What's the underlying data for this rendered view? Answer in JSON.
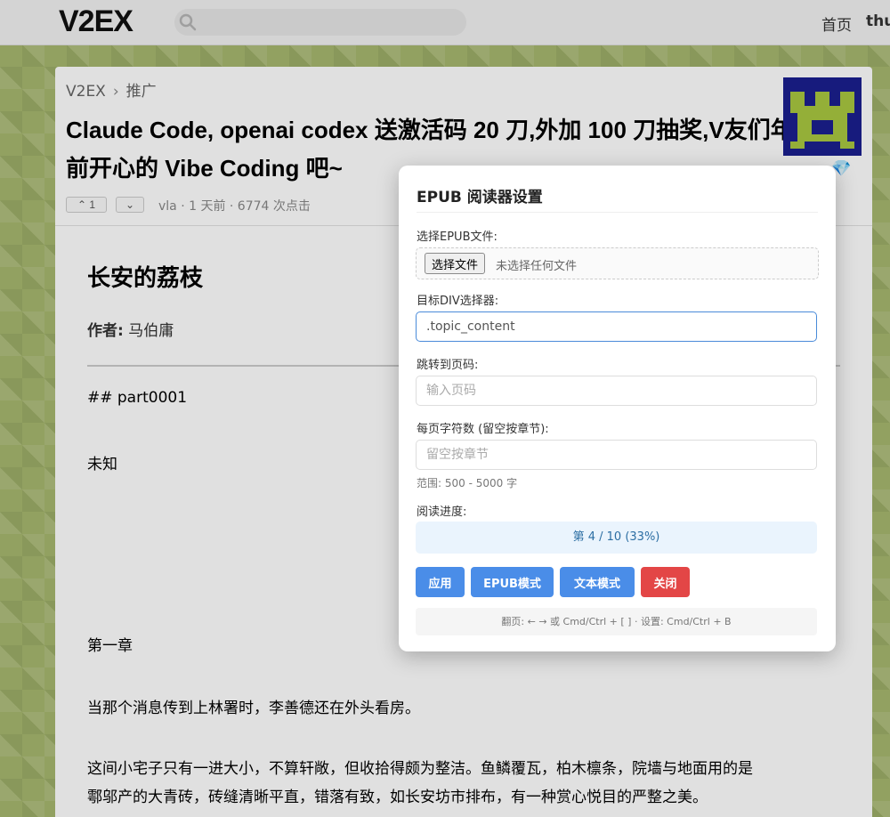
{
  "header": {
    "logo": "V2EX",
    "search_placeholder": "",
    "nav_home": "首页",
    "nav_user": "thu"
  },
  "topic": {
    "breadcrumb_root": "V2EX",
    "breadcrumb_sep": "›",
    "breadcrumb_node": "推广",
    "title": "Claude Code, openai codex 送激活码 20 刀,外加 100 刀抽奖,V友们年前开心的 Vibe Coding 吧~",
    "upvote_count": "1",
    "meta": "vla · 1 天前 · 6774 次点击"
  },
  "content": {
    "book_title": "长安的荔枝",
    "author_label": "作者:",
    "author_name": "马伯庸",
    "heading": "## part0001",
    "unknown": "未知",
    "chapter": "第一章",
    "para1": "当那个消息传到上林署时，李善德还在外头看房。",
    "para2_line1": "这间小宅子只有一进大小，不算轩敞，但收拾得颇为整洁。鱼鳞覆瓦，柏木檩条，院墙与地面用的是",
    "para2_line2": "鄠邬产的大青砖，砖缝清晰平直，错落有致，如长安坊市排布，有一种赏心悦目的严整之美。"
  },
  "dialog": {
    "title": "EPUB 阅读器设置",
    "file_label": "选择EPUB文件:",
    "file_button": "选择文件",
    "file_status": "未选择任何文件",
    "selector_label": "目标DIV选择器:",
    "selector_value": ".topic_content",
    "page_label": "跳转到页码:",
    "page_placeholder": "输入页码",
    "chars_label": "每页字符数 (留空按章节):",
    "chars_placeholder": "留空按章节",
    "range_hint": "范围: 500 - 5000 字",
    "progress_label": "阅读进度:",
    "progress_text": "第 4 / 10 (33%)",
    "btn_apply": "应用",
    "btn_epub": "EPUB模式",
    "btn_text": "文本模式",
    "btn_close": "关闭",
    "shortcut": "翻页: ← → 或 Cmd/Ctrl + [ ] · 设置: Cmd/Ctrl + B"
  },
  "icons": {
    "search": "search-icon",
    "upvote": "arrow-up-icon",
    "downvote": "arrow-down-icon",
    "gem": "gem-icon",
    "avatar": "pixel-avatar"
  },
  "colors": {
    "primary_button": "#4a8de8",
    "close_button": "#e34646",
    "progress_bg": "#eaf4fd",
    "avatar_bg": "#1b1f8f",
    "avatar_fg": "#a9c840"
  }
}
